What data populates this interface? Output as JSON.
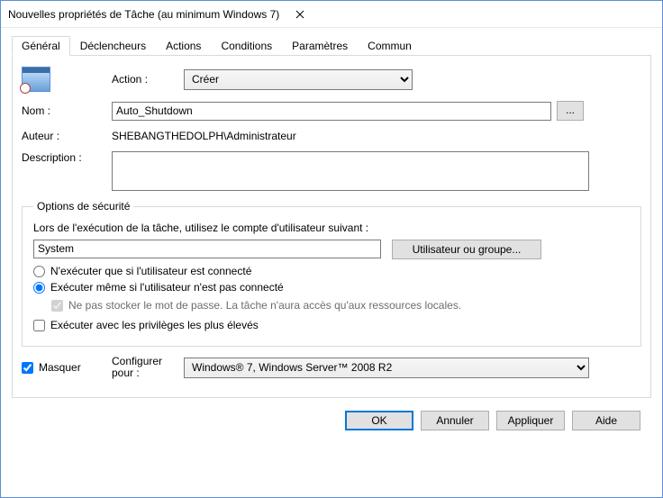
{
  "window": {
    "title": "Nouvelles propriétés de Tâche (au minimum Windows 7)"
  },
  "tabs": {
    "general": "Général",
    "declencheurs": "Déclencheurs",
    "actions": "Actions",
    "conditions": "Conditions",
    "parametres": "Paramètres",
    "commun": "Commun"
  },
  "general": {
    "action_label": "Action :",
    "action_value": "Créer",
    "nom_label": "Nom :",
    "nom_value": "Auto_Shutdown",
    "auteur_label": "Auteur :",
    "auteur_value": "SHEBANGTHEDOLPH\\Administrateur",
    "description_label": "Description :",
    "description_value": ""
  },
  "security": {
    "legend": "Options de sécurité",
    "intro": "Lors de l'exécution de la tâche, utilisez le compte d'utilisateur suivant :",
    "account": "System",
    "change_user_btn": "Utilisateur ou groupe...",
    "radio_logged_on": "N'exécuter que si l'utilisateur est connecté",
    "radio_not_logged_on": "Exécuter même si l'utilisateur n'est pas connecté",
    "no_store_pwd": "Ne pas stocker le mot de passe. La tâche n'aura accès qu'aux ressources locales.",
    "highest_priv": "Exécuter avec les privilèges les plus élevés"
  },
  "footer": {
    "hide_label": "Masquer",
    "configure_label": "Configurer pour :",
    "configure_value": "Windows® 7, Windows Server™ 2008 R2"
  },
  "buttons": {
    "ok": "OK",
    "cancel": "Annuler",
    "apply": "Appliquer",
    "help": "Aide"
  }
}
